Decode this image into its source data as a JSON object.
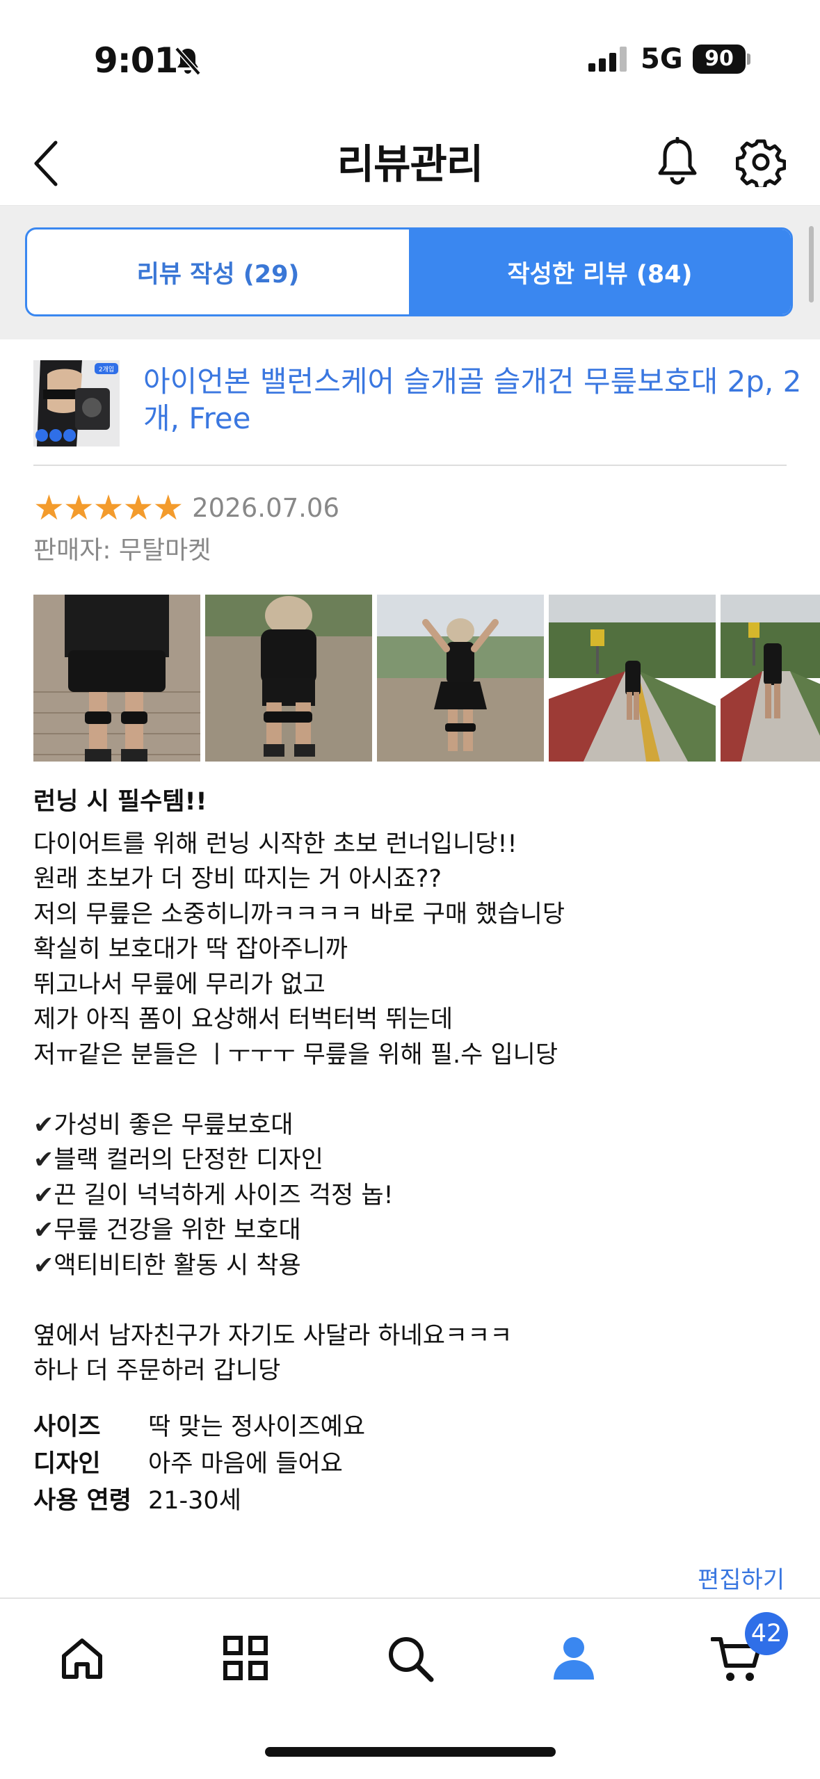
{
  "status_bar": {
    "time": "9:01",
    "network": "5G",
    "battery": "90"
  },
  "nav": {
    "title": "리뷰관리"
  },
  "tabs": [
    {
      "label": "리뷰 작성 (29)",
      "active": false
    },
    {
      "label": "작성한 리뷰 (84)",
      "active": true
    }
  ],
  "product": {
    "name": "아이언본 밸런스케어 슬개골 슬개건 무릎보호대 2p, 2개, Free",
    "thumb_badge": "2개입"
  },
  "review": {
    "stars": 5,
    "date": "2026.07.06",
    "seller": "판매자: 무탈마켓",
    "headline": "런닝 시 필수템!!",
    "body_lines": [
      "다이어트를 위해 런닝 시작한 초보 런너입니당!!",
      "원래 초보가 더 장비 따지는 거 아시죠??",
      "저의 무릎은 소중히니까ㅋㅋㅋㅋ 바로 구매 했습니당",
      "확실히 보호대가 딱 잡아주니까",
      "뛰고나서 무릎에 무리가 없고",
      "제가 아직 폼이 요상해서 터벅터벅 뛰는데",
      "저ㅠ같은 분들은 ㅣㅜㅜㅜ 무릎을 위해 필.수 입니당"
    ],
    "check_items": [
      "가성비 좋은 무릎보호대",
      "블랙 컬러의 단정한 디자인",
      "끈 길이 넉넉하게 사이즈 걱정 놉!",
      "무릎 건강을 위한 보호대",
      "액티비티한 활동 시 착용"
    ],
    "closing_lines": [
      "옆에서 남자친구가 자기도 사달라 하네요ㅋㅋㅋ",
      "하나 더 주문하러 갑니당"
    ],
    "attributes": [
      {
        "key": "사이즈",
        "value": "딱 맞는 정사이즈예요"
      },
      {
        "key": "디자인",
        "value": "아주 마음에 들어요"
      },
      {
        "key": "사용 연령",
        "value": "21-30세"
      }
    ],
    "edit_label": "편집하기"
  },
  "tab_bar": {
    "items": [
      {
        "icon": "home-icon"
      },
      {
        "icon": "grid-icon"
      },
      {
        "icon": "search-icon"
      },
      {
        "icon": "person-icon",
        "active": true
      },
      {
        "icon": "cart-icon"
      }
    ],
    "cart_badge": "42"
  },
  "colors": {
    "accent": "#3a87f0",
    "link": "#3a77e0",
    "star": "#f39b2c"
  }
}
